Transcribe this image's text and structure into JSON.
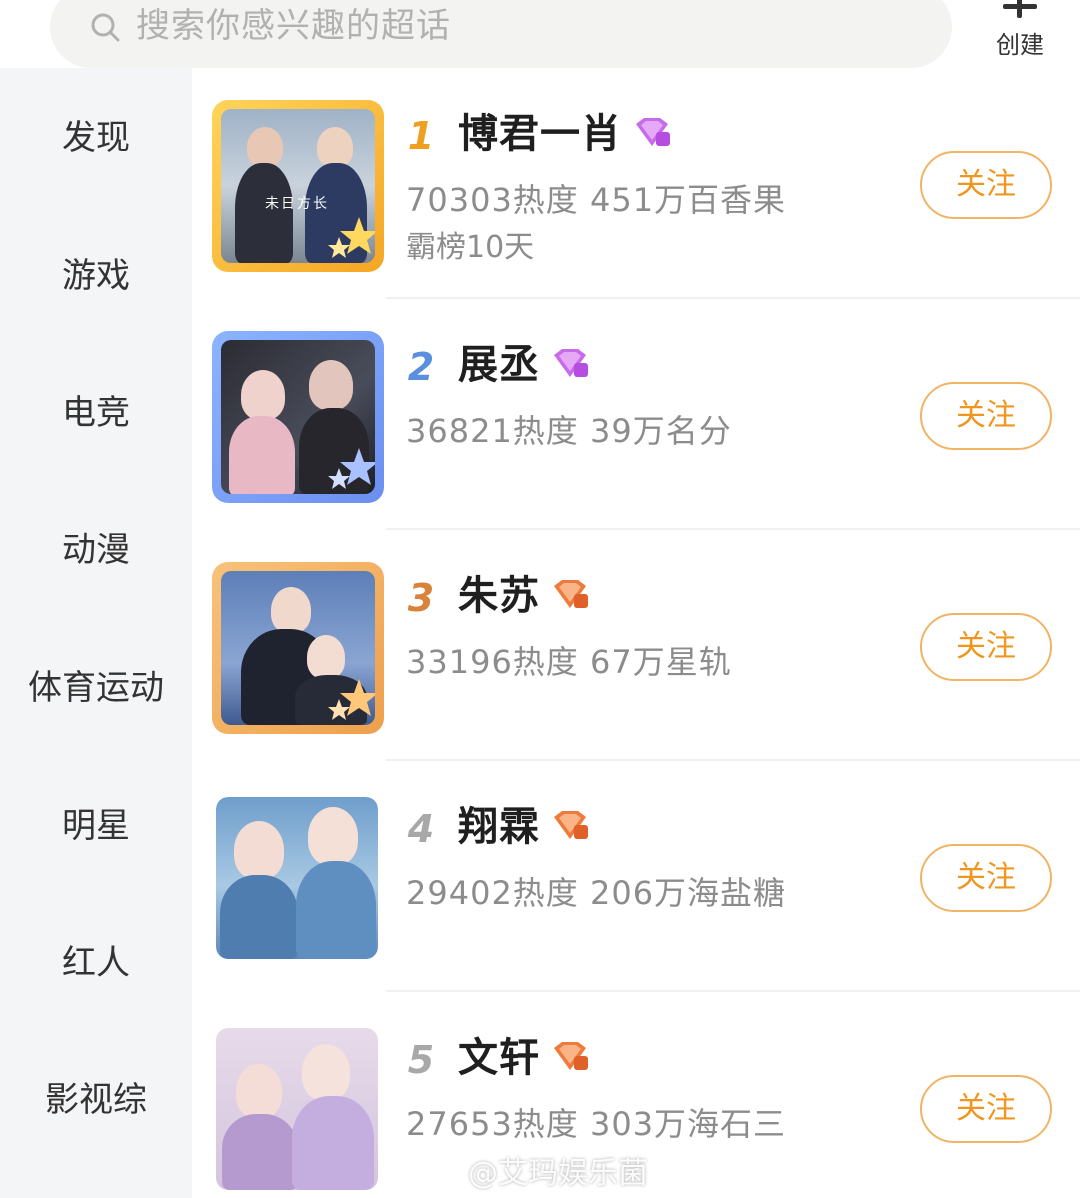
{
  "search": {
    "placeholder": "搜索你感兴趣的超话",
    "icon": "search-icon"
  },
  "create": {
    "label": "创建",
    "icon": "plus-icon"
  },
  "sidebar": {
    "items": [
      {
        "label": "发现"
      },
      {
        "label": "游戏"
      },
      {
        "label": "电竞"
      },
      {
        "label": "动漫"
      },
      {
        "label": "体育运动"
      },
      {
        "label": "明星"
      },
      {
        "label": "红人"
      },
      {
        "label": "影视综"
      }
    ]
  },
  "list": {
    "follow_label": "关注",
    "items": [
      {
        "rank": "1",
        "name": "博君一肖",
        "stats": "70303热度 451万百香果",
        "extra": "霸榜10天",
        "badge": "purple-diamond-badge",
        "frame": "gold",
        "avatar_text": "未日方长"
      },
      {
        "rank": "2",
        "name": "展丞",
        "stats": "36821热度 39万名分",
        "badge": "purple-diamond-badge",
        "frame": "blue"
      },
      {
        "rank": "3",
        "name": "朱苏",
        "stats": "33196热度 67万星轨",
        "badge": "orange-diamond-badge",
        "frame": "bronze"
      },
      {
        "rank": "4",
        "name": "翔霖",
        "stats": "29402热度 206万海盐糖",
        "badge": "orange-diamond-badge",
        "frame": "none"
      },
      {
        "rank": "5",
        "name": "文轩",
        "stats": "27653热度 303万海石三",
        "badge": "orange-diamond-badge",
        "frame": "none"
      }
    ]
  },
  "watermark": {
    "text": "@艾玛娱乐菌"
  },
  "colors": {
    "accent": "#f0961e",
    "follow_border": "#f0b465",
    "sidebar_bg": "#f4f5f7",
    "rank1": "#f0a020",
    "rank2": "#5a8fe0",
    "rank3": "#d9833a",
    "rank_other": "#a8a8a8"
  }
}
